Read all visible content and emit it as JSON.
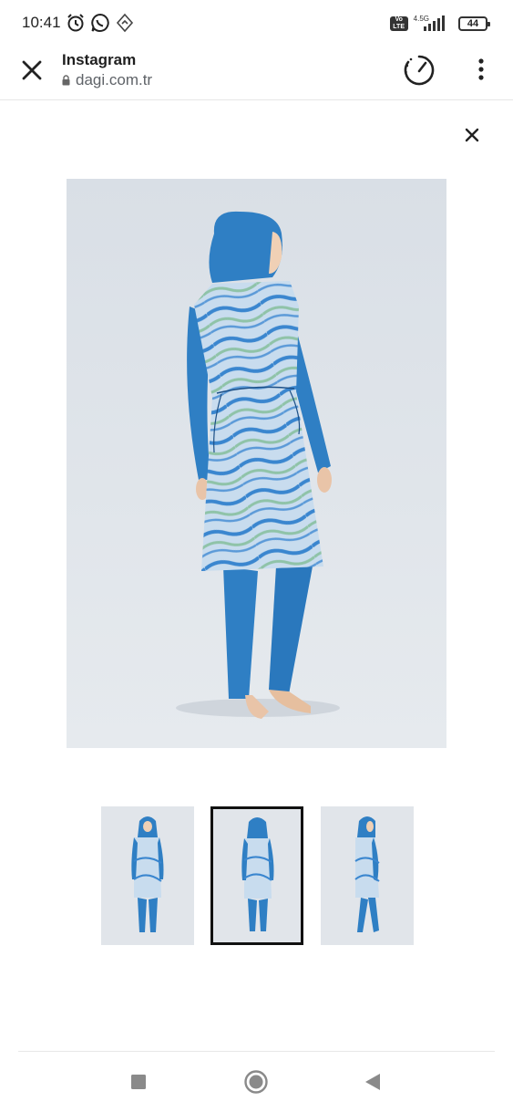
{
  "status_bar": {
    "time": "10:41",
    "volte": "Vo LTE",
    "network": "4.5G",
    "battery": "44",
    "icons": [
      "alarm-icon",
      "whatsapp-icon",
      "location-icon",
      "signal-icon",
      "battery-icon"
    ]
  },
  "toolbar": {
    "title": "Instagram",
    "url": "dagi.com.tr",
    "icons": [
      "close-icon",
      "lock-icon",
      "speedometer-icon",
      "more-vertical-icon"
    ]
  },
  "gallery": {
    "main_image": "Model wearing blue hooded swimsuit with wave print tunic, back view",
    "thumbnails": [
      {
        "name": "thumbnail-front",
        "selected": false
      },
      {
        "name": "thumbnail-back",
        "selected": true
      },
      {
        "name": "thumbnail-side",
        "selected": false
      }
    ]
  },
  "colors": {
    "accent_blue": "#2f7fc4",
    "print_light": "#b9d3ea",
    "background": "#ffffff",
    "photo_bg": "#dfe4ea"
  },
  "nav_bar": {
    "icons": [
      "recents-square-icon",
      "home-circle-icon",
      "back-triangle-icon"
    ]
  }
}
